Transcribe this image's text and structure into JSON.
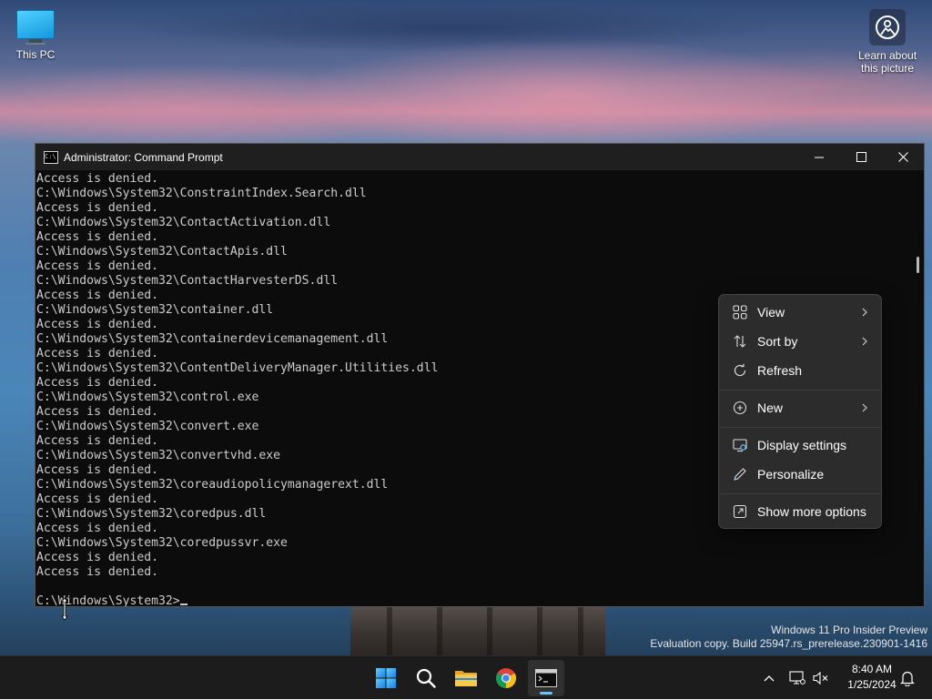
{
  "desktop": {
    "icons": [
      {
        "label": "This PC"
      },
      {
        "label": "Learn about this picture"
      }
    ]
  },
  "window": {
    "title": "Administrator: Command Prompt",
    "icon_text": "C:\\",
    "lines": [
      "Access is denied.",
      "C:\\Windows\\System32\\ConstraintIndex.Search.dll",
      "Access is denied.",
      "C:\\Windows\\System32\\ContactActivation.dll",
      "Access is denied.",
      "C:\\Windows\\System32\\ContactApis.dll",
      "Access is denied.",
      "C:\\Windows\\System32\\ContactHarvesterDS.dll",
      "Access is denied.",
      "C:\\Windows\\System32\\container.dll",
      "Access is denied.",
      "C:\\Windows\\System32\\containerdevicemanagement.dll",
      "Access is denied.",
      "C:\\Windows\\System32\\ContentDeliveryManager.Utilities.dll",
      "Access is denied.",
      "C:\\Windows\\System32\\control.exe",
      "Access is denied.",
      "C:\\Windows\\System32\\convert.exe",
      "Access is denied.",
      "C:\\Windows\\System32\\convertvhd.exe",
      "Access is denied.",
      "C:\\Windows\\System32\\coreaudiopolicymanagerext.dll",
      "Access is denied.",
      "C:\\Windows\\System32\\coredpus.dll",
      "Access is denied.",
      "C:\\Windows\\System32\\coredpussvr.exe",
      "Access is denied.",
      "Access is denied.",
      ""
    ],
    "prompt": "C:\\Windows\\System32>"
  },
  "context_menu": {
    "view": "View",
    "sort_by": "Sort by",
    "refresh": "Refresh",
    "new": "New",
    "display_settings": "Display settings",
    "personalize": "Personalize",
    "show_more": "Show more options"
  },
  "watermark": {
    "line1": "Windows 11 Pro Insider Preview",
    "line2": "Evaluation copy. Build 25947.rs_prerelease.230901-1416"
  },
  "taskbar": {
    "apps": [
      "start-icon",
      "search-icon",
      "file-explorer-icon",
      "chrome-icon",
      "command-prompt-icon"
    ],
    "time": "8:40 AM",
    "date": "1/25/2024"
  },
  "colors": {
    "accent": "#6cc2ff",
    "console_bg": "#0c0c0c",
    "console_fg": "#cccccc",
    "menu_bg": "#2c2c2c"
  }
}
